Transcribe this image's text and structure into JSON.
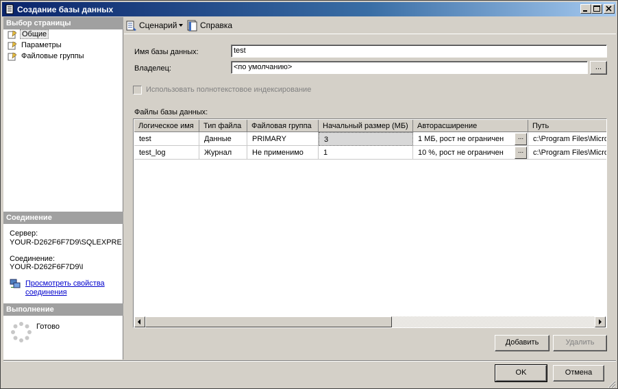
{
  "window": {
    "title": "Создание базы данных"
  },
  "left": {
    "select_page_header": "Выбор страницы",
    "pages": [
      {
        "label": "Общие"
      },
      {
        "label": "Параметры"
      },
      {
        "label": "Файловые группы"
      }
    ],
    "connection_header": "Соединение",
    "server_label": "Сервер:",
    "server_value": "YOUR-D262F6F7D9\\SQLEXPRE",
    "connection_label": "Соединение:",
    "connection_value": "YOUR-D262F6F7D9\\I",
    "view_props_line1": "Просмотреть свойства",
    "view_props_line2": "соединения",
    "progress_header": "Выполнение",
    "progress_status": "Готово"
  },
  "toolbar": {
    "script_label": "Сценарий",
    "help_label": "Справка"
  },
  "form": {
    "db_name_label": "Имя базы данных:",
    "db_name_value": "test",
    "owner_label": "Владелец:",
    "owner_value": "<по умолчанию>",
    "fulltext_label": "Использовать полнотекстовое индексирование",
    "files_label": "Файлы базы данных:"
  },
  "grid": {
    "columns": [
      "Логическое имя",
      "Тип файла",
      "Файловая группа",
      "Начальный размер (МБ)",
      "Авторасширение",
      "Путь"
    ],
    "rows": [
      [
        "test",
        "Данные",
        "PRIMARY",
        "3",
        "1 МБ, рост не ограничен",
        "c:\\Program Files\\Micro"
      ],
      [
        "test_log",
        "Журнал",
        "Не применимо",
        "1",
        "10 %, рост не ограничен",
        "c:\\Program Files\\Micro"
      ]
    ]
  },
  "buttons": {
    "ellipsis": "...",
    "add": "Добавить",
    "remove": "Удалить",
    "ok": "OK",
    "cancel": "Отмена"
  }
}
